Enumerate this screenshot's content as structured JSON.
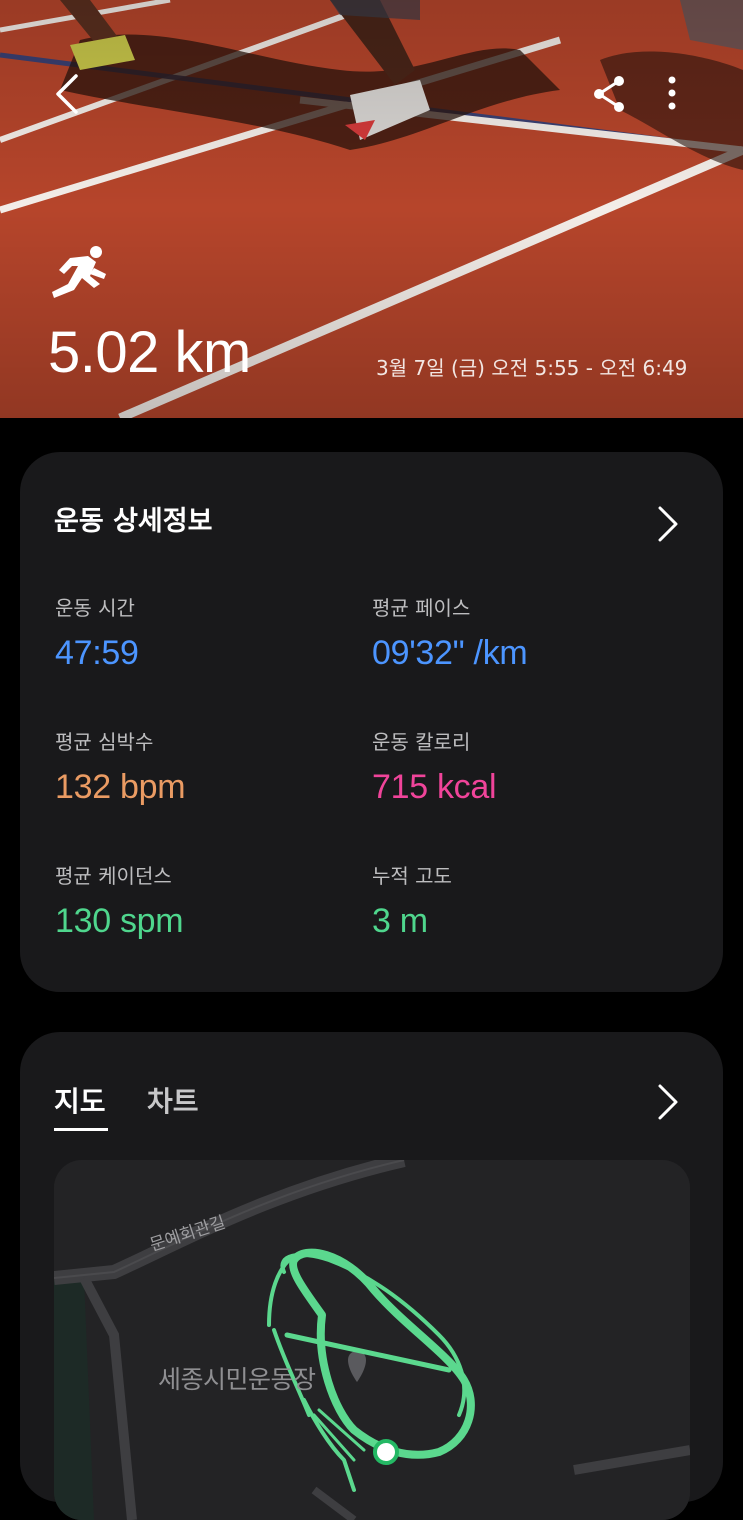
{
  "header": {
    "distance": "5.02 km",
    "datetime": "3월 7일 (금) 오전 5:55 - 오전 6:49"
  },
  "details": {
    "title": "운동 상세정보",
    "stats": [
      {
        "label": "운동 시간",
        "value": "47:59",
        "color": "#4c95ff"
      },
      {
        "label": "평균 페이스",
        "value": "09'32\" /km",
        "color": "#4c95ff"
      },
      {
        "label": "평균 심박수",
        "value": "132 bpm",
        "color": "#ea9b63"
      },
      {
        "label": "운동 칼로리",
        "value": "715 kcal",
        "color": "#f0449a"
      },
      {
        "label": "평균 케이던스",
        "value": "130 spm",
        "color": "#4fd68d"
      },
      {
        "label": "누적 고도",
        "value": "3 m",
        "color": "#4fd68d"
      }
    ]
  },
  "map_section": {
    "tabs": [
      "지도",
      "차트"
    ],
    "active_tab": "지도",
    "road_label": "문예회관길",
    "place_label": "세종시민운동장",
    "route_color": "#5bd88e"
  },
  "icons": {
    "back": "back-arrow-icon",
    "share": "share-icon",
    "more": "more-vertical-icon",
    "activity": "running-icon",
    "chevron": "chevron-right-icon"
  }
}
